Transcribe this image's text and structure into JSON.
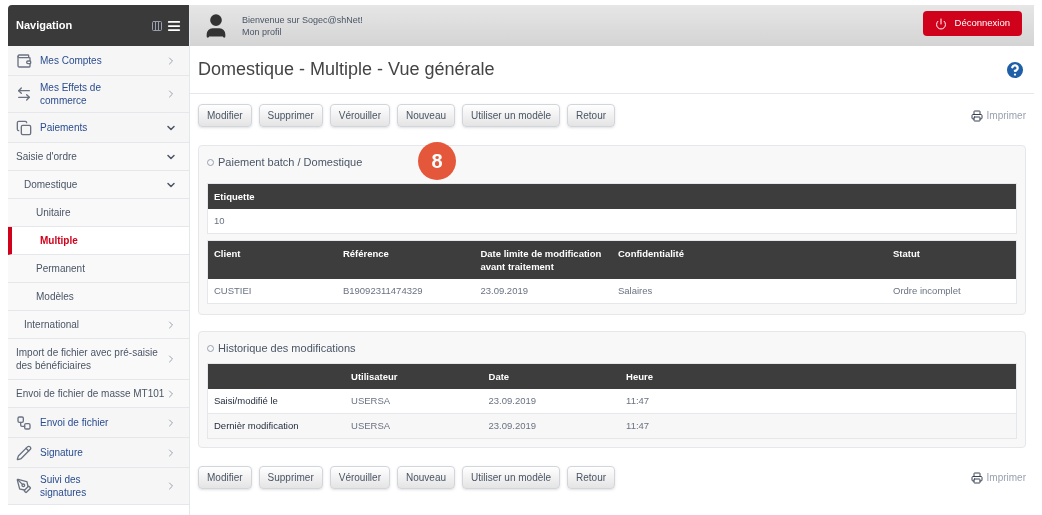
{
  "sidebar": {
    "title": "Navigation",
    "items": [
      {
        "label": "Mes Comptes",
        "selected": false,
        "expanded": false
      },
      {
        "label": "Mes Effets de commerce",
        "selected": false,
        "expanded": false
      },
      {
        "label": "Paiements",
        "selected": false,
        "expanded": true,
        "children": [
          {
            "label": "Saisie d'ordre",
            "selected": false,
            "expanded": true,
            "children": [
              {
                "label": "Domestique",
                "selected": false,
                "expanded": true,
                "children": [
                  {
                    "label": "Unitaire",
                    "selected": false
                  },
                  {
                    "label": "Multiple",
                    "selected": true
                  },
                  {
                    "label": "Permanent",
                    "selected": false
                  },
                  {
                    "label": "Modèles",
                    "selected": false
                  }
                ]
              },
              {
                "label": "International",
                "selected": false,
                "expanded": false
              }
            ]
          },
          {
            "label": "Import de fichier avec pré-saisie des bénéficiaires",
            "selected": false,
            "expanded": false
          },
          {
            "label": "Envoi de fichier de masse MT101",
            "selected": false,
            "expanded": false
          }
        ]
      },
      {
        "label": "Envoi de fichier",
        "selected": false,
        "expanded": false
      },
      {
        "label": "Signature",
        "selected": false,
        "expanded": false
      },
      {
        "label": "Suivi des signatures",
        "selected": false,
        "expanded": false
      }
    ]
  },
  "header": {
    "welcome": "Bienvenue sur Sogec@shNet!",
    "profile_link": "Mon profil",
    "logout_button": "Déconnexion"
  },
  "page_title": "Domestique - Multiple - Vue générale",
  "toolbar_top": {
    "buttons": [
      "Modifier",
      "Supprimer",
      "Vérouiller",
      "Nouveau",
      "Utiliser un modèle",
      "Retour"
    ],
    "print_link": "Imprimer"
  },
  "callout": "8",
  "batch_panel": {
    "title": "Paiement batch / Domestique",
    "label_table": {
      "columns": [
        "Etiquette"
      ],
      "rows": [
        [
          "10"
        ]
      ]
    },
    "order_table": {
      "columns": [
        "Client",
        "Référence",
        "Date limite de modification avant traitement",
        "Confidentialité",
        "Statut"
      ],
      "rows": [
        [
          "CUSTIEI",
          "B19092311474329",
          "23.09.2019",
          "Salaires",
          "Ordre incomplet"
        ]
      ]
    }
  },
  "history_panel": {
    "title": "Historique des modifications",
    "columns": [
      "",
      "Utilisateur",
      "Date",
      "Heure"
    ],
    "rows": [
      [
        "Saisi/modifié le",
        "USERSA",
        "23.09.2019",
        "11:47"
      ],
      [
        "Dernièr modification",
        "USERSA",
        "23.09.2019",
        "11:47"
      ]
    ]
  },
  "toolbar_bottom": {
    "buttons": [
      "Modifier",
      "Supprimer",
      "Vérouiller",
      "Nouveau",
      "Utiliser un modèle",
      "Retour"
    ],
    "print_link": "Imprimer"
  }
}
